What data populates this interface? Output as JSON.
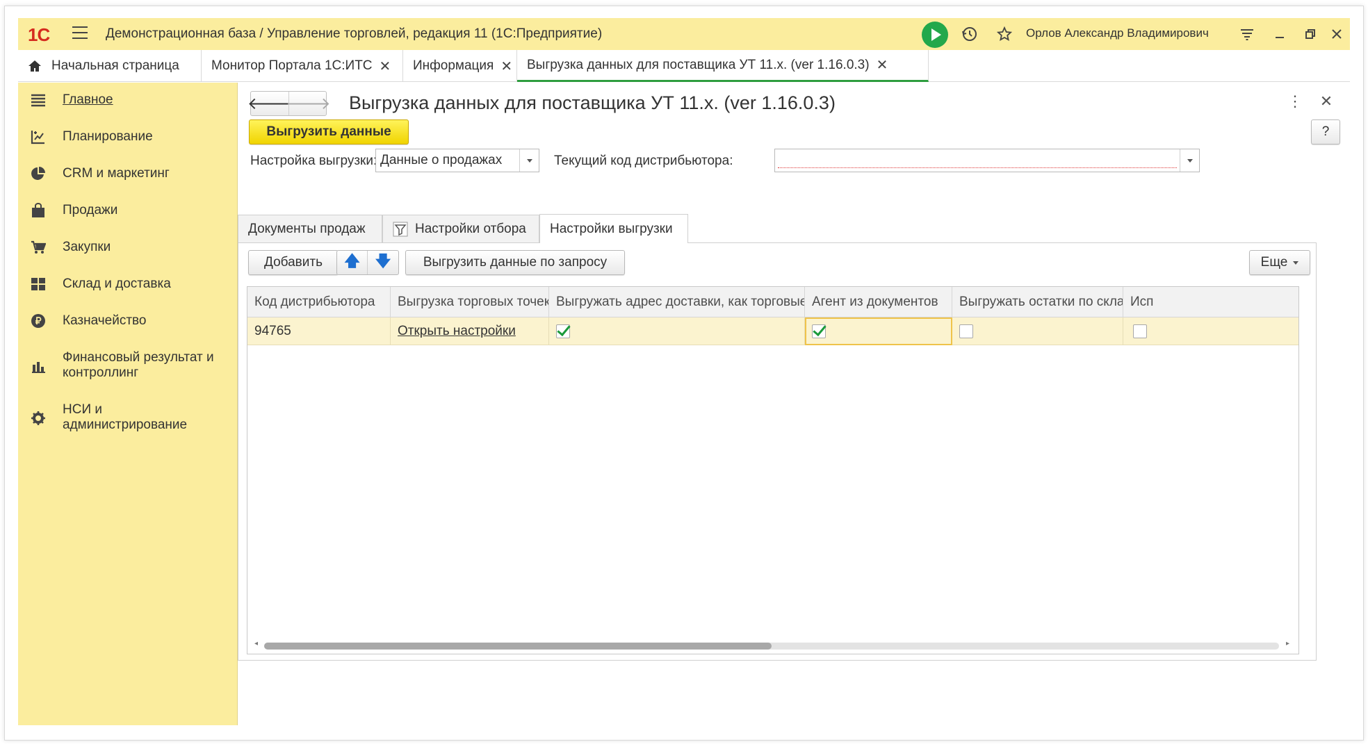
{
  "titlebar": {
    "logo": "1С",
    "app_title": "Демонстрационная база / Управление торговлей, редакция 11  (1С:Предприятие)",
    "user_name": "Орлов Александр Владимирович"
  },
  "tabs": [
    {
      "label": "Начальная страница",
      "closable": false
    },
    {
      "label": "Монитор Портала 1С:ИТС",
      "closable": true
    },
    {
      "label": "Информация",
      "closable": true
    },
    {
      "label": "Выгрузка данных для поставщика УТ 11.x. (ver 1.16.0.3)",
      "closable": true,
      "active": true
    }
  ],
  "close_glyph": "✕",
  "sidebar": {
    "items": [
      {
        "label": "Главное",
        "icon": "list-icon"
      },
      {
        "label": "Планирование",
        "icon": "planning-icon"
      },
      {
        "label": "CRM и маркетинг",
        "icon": "pie-chart-icon"
      },
      {
        "label": "Продажи",
        "icon": "bag-icon"
      },
      {
        "label": "Закупки",
        "icon": "cart-icon"
      },
      {
        "label": "Склад и доставка",
        "icon": "warehouse-icon"
      },
      {
        "label": "Казначейство",
        "icon": "ruble-icon"
      },
      {
        "label": "Финансовый результат и контроллинг",
        "icon": "bar-chart-icon"
      },
      {
        "label": "НСИ и администрирование",
        "icon": "gear-icon"
      }
    ]
  },
  "form": {
    "title": "Выгрузка данных для поставщика УТ 11.x. (ver 1.16.0.3)",
    "export_button": "Выгрузить данные",
    "help_button": "?",
    "settings_label": "Настройка выгрузки:",
    "settings_value": "Данные о продажах",
    "distributor_label": "Текущий код дистрибьютора:",
    "distributor_value": "",
    "inner_tabs": [
      {
        "label": "Документы продаж"
      },
      {
        "label": "Настройки отбора"
      },
      {
        "label": "Настройки выгрузки",
        "active": true
      }
    ],
    "toolbar": {
      "add": "Добавить",
      "move_up": "🡅",
      "move_down": "🡇",
      "export_by_request": "Выгрузить данные по запросу",
      "more": "Еще"
    },
    "grid": {
      "columns": [
        "Код дистрибьютора",
        "Выгрузка торговых точек/...",
        "Выгружать адрес доставки, как торговые точки",
        "Агент из документов",
        "Выгружать остатки по складам",
        "Исп"
      ],
      "rows": [
        {
          "code": "94765",
          "outlets": "Открыть настройки",
          "delivery_as_outlets": true,
          "agent_from_docs": true,
          "stock_by_warehouse": false,
          "use": false
        }
      ]
    }
  }
}
